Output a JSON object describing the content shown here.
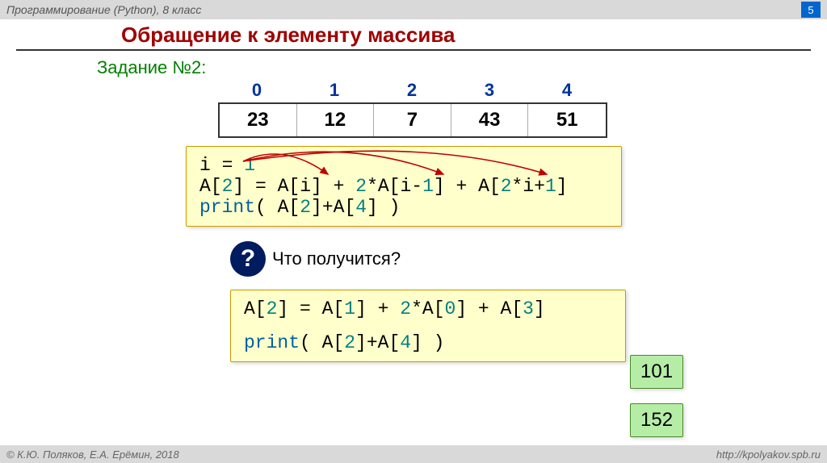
{
  "header": {
    "course": "Программирование (Python), 8 класс",
    "page": "5"
  },
  "title": "Обращение к элементу массива",
  "task_label": "Задание №2:",
  "array": {
    "indices": [
      "0",
      "1",
      "2",
      "3",
      "4"
    ],
    "values": [
      "23",
      "12",
      "7",
      "43",
      "51"
    ]
  },
  "code1": {
    "line1": {
      "a": "i = ",
      "b": "1"
    },
    "line2": {
      "a": "A[",
      "b": "2",
      "c": "] = A[i] + ",
      "d": "2",
      "e": "*A[i-",
      "f": "1",
      "g": "] + A[",
      "h": "2",
      "i": "*i+",
      "j": "1",
      "k": "]"
    },
    "line3": {
      "a": "print",
      "b": "( A[",
      "c": "2",
      "d": "]+A[",
      "e": "4",
      "f": "] )"
    }
  },
  "prompt": "Что получится?",
  "code2": {
    "line1": {
      "a": "A[",
      "b": "2",
      "c": "] = A[",
      "d": "1",
      "e": "] + ",
      "f": "2",
      "g": "*A[",
      "h": "0",
      "i": "] + A[",
      "j": "3",
      "k": "]"
    },
    "line2": {
      "a": "print",
      "b": "( A[",
      "c": "2",
      "d": "]+A[",
      "e": "4",
      "f": "] )"
    }
  },
  "results": {
    "r1": "101",
    "r2": "152"
  },
  "footer": {
    "left": "© К.Ю. Поляков, Е.А. Ерёмин, 2018",
    "right": "http://kpolyakov.spb.ru"
  }
}
